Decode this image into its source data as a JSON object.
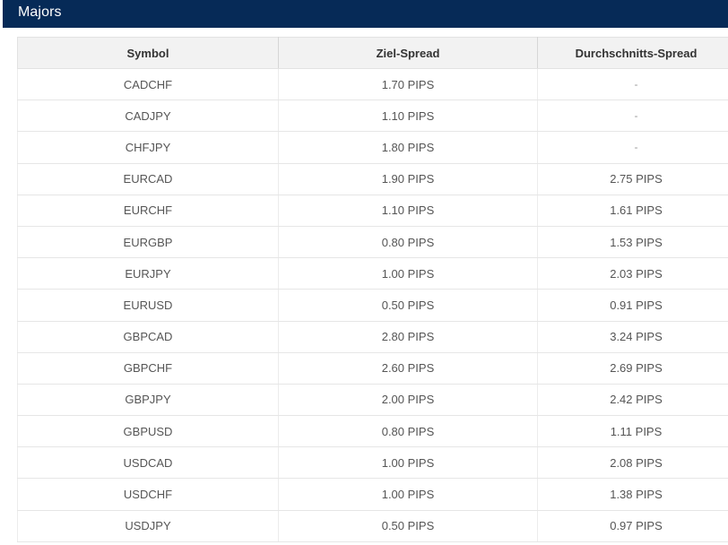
{
  "header": {
    "title": "Majors"
  },
  "table": {
    "columns": [
      "Symbol",
      "Ziel-Spread",
      "Durchschnitts-Spread"
    ],
    "rows": [
      [
        "CADCHF",
        "1.70 PIPS",
        "-"
      ],
      [
        "CADJPY",
        "1.10 PIPS",
        "-"
      ],
      [
        "CHFJPY",
        "1.80 PIPS",
        "-"
      ],
      [
        "EURCAD",
        "1.90 PIPS",
        "2.75 PIPS"
      ],
      [
        "EURCHF",
        "1.10 PIPS",
        "1.61 PIPS"
      ],
      [
        "EURGBP",
        "0.80 PIPS",
        "1.53 PIPS"
      ],
      [
        "EURJPY",
        "1.00 PIPS",
        "2.03 PIPS"
      ],
      [
        "EURUSD",
        "0.50 PIPS",
        "0.91 PIPS"
      ],
      [
        "GBPCAD",
        "2.80 PIPS",
        "3.24 PIPS"
      ],
      [
        "GBPCHF",
        "2.60 PIPS",
        "2.69 PIPS"
      ],
      [
        "GBPJPY",
        "2.00 PIPS",
        "2.42 PIPS"
      ],
      [
        "GBPUSD",
        "0.80 PIPS",
        "1.11 PIPS"
      ],
      [
        "USDCAD",
        "1.00 PIPS",
        "2.08 PIPS"
      ],
      [
        "USDCHF",
        "1.00 PIPS",
        "1.38 PIPS"
      ],
      [
        "USDJPY",
        "0.50 PIPS",
        "0.97 PIPS"
      ]
    ]
  },
  "colors": {
    "header_bg": "#062a57",
    "header_text": "#ffffff",
    "table_header_bg": "#f2f2f2",
    "cell_text": "#555555"
  }
}
